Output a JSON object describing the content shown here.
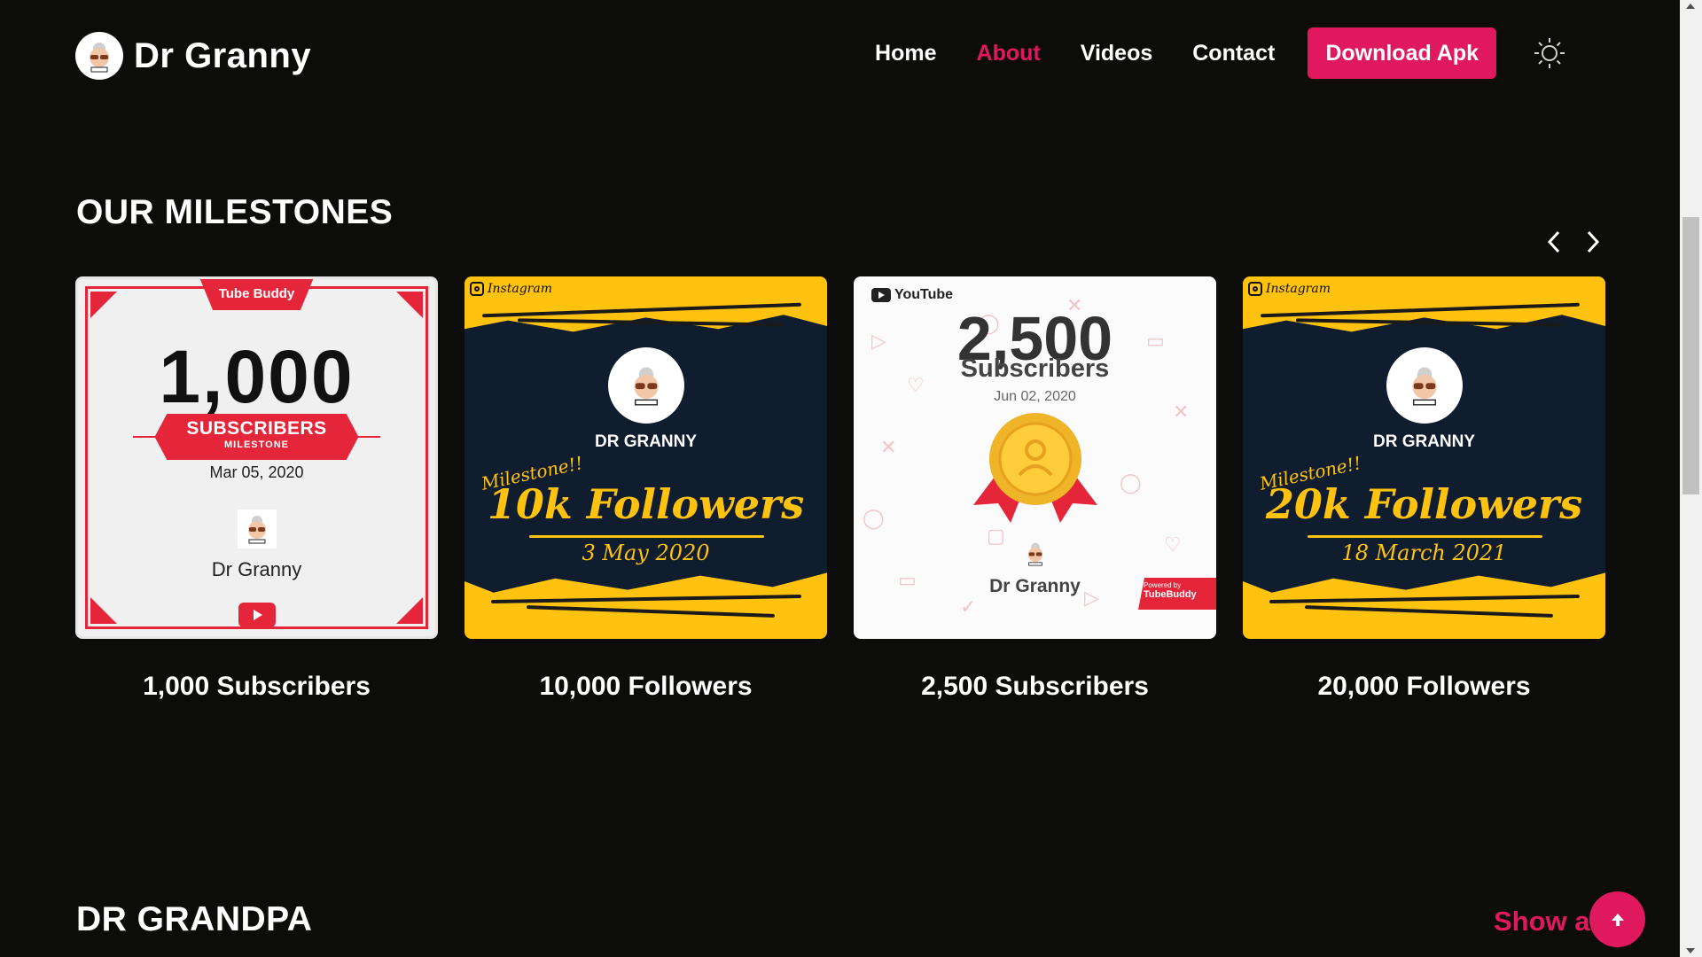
{
  "nav": {
    "brand": "Dr Granny",
    "links": [
      "Home",
      "About",
      "Videos",
      "Contact"
    ],
    "active_link": "About",
    "download_label": "Download Apk",
    "theme_icon": "sun-icon"
  },
  "milestones": {
    "title": "OUR MILESTONES",
    "cards": [
      {
        "caption": "1,000 Subscribers",
        "image": {
          "badge": "Tube Buddy",
          "number": "1,000",
          "ribbon_main": "SUBSCRIBERS",
          "ribbon_sub": "MILESTONE",
          "date": "Mar 05, 2020",
          "name": "Dr Granny"
        }
      },
      {
        "caption": "10,000 Followers",
        "image": {
          "platform": "Instagram",
          "name": "DR GRANNY",
          "tag": "Milestone!!",
          "headline": "10k Followers",
          "date": "3 May 2020"
        }
      },
      {
        "caption": "2,500 Subscribers",
        "image": {
          "platform": "YouTube",
          "number": "2,500",
          "unit": "Subscribers",
          "date": "Jun 02, 2020",
          "name": "Dr Granny",
          "powered_by": "Powered by",
          "badge": "TubeBuddy"
        }
      },
      {
        "caption": "20,000 Followers",
        "image": {
          "platform": "Instagram",
          "name": "DR GRANNY",
          "tag": "Milestone!!",
          "headline": "20k Followers",
          "date": "18 March 2021"
        }
      }
    ]
  },
  "grandpa": {
    "title": "DR GRANDPA",
    "show_all": "Show all"
  },
  "colors": {
    "background": "#0c0c0a",
    "accent": "#e0195f",
    "instagram_yellow": "#ffc20e",
    "instagram_navy": "#0f1d2f",
    "tubebuddy_red": "#e5263a"
  }
}
